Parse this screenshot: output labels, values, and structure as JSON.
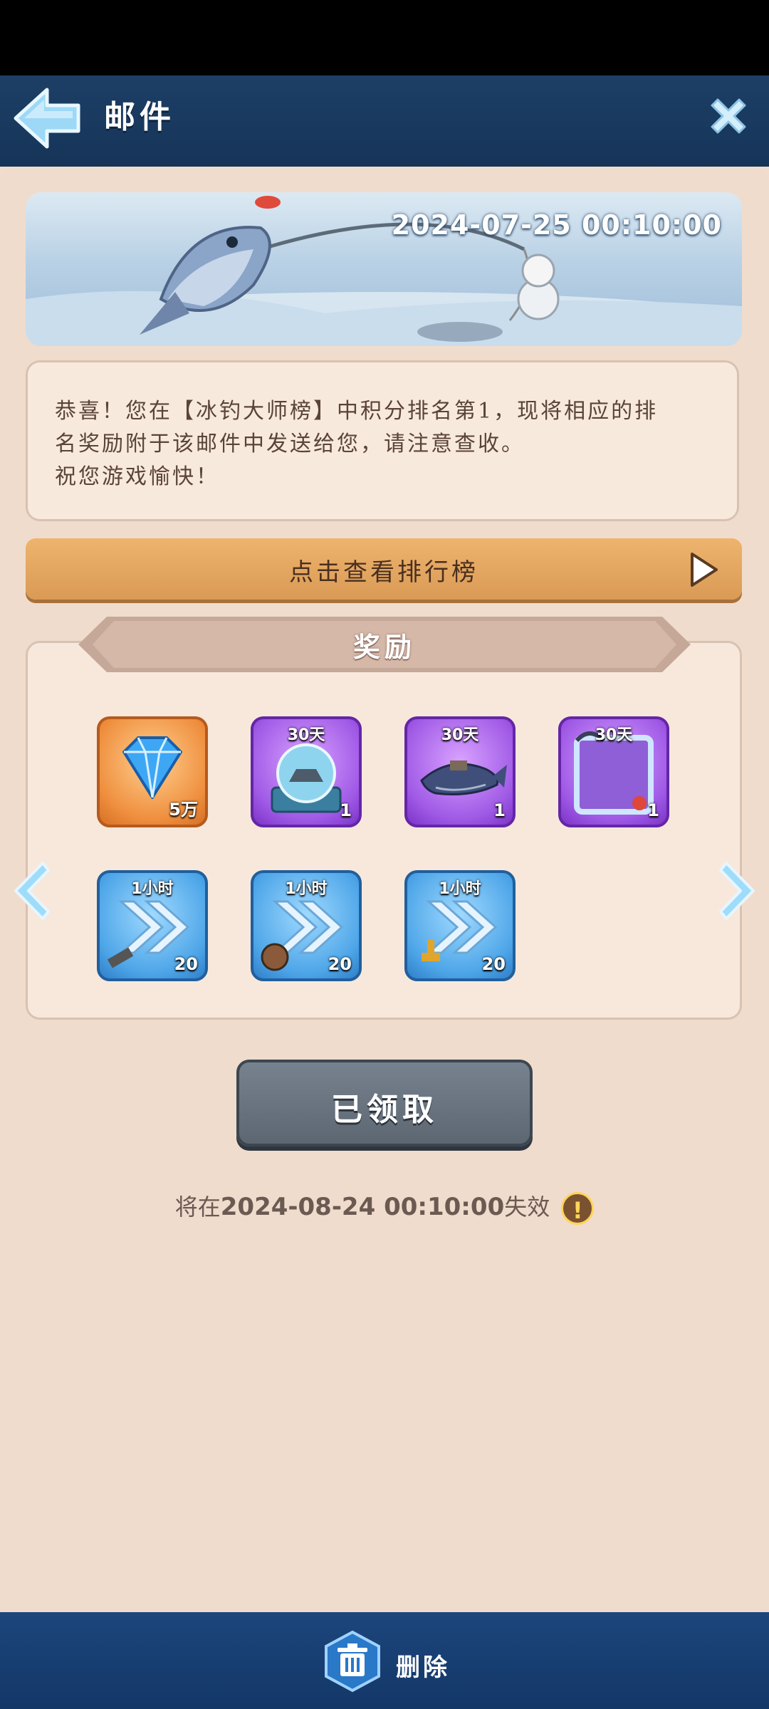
{
  "header": {
    "title": "邮件",
    "back_icon": "back-arrow-icon",
    "close_icon": "close-icon"
  },
  "mail": {
    "date": "2024-07-25 00:10:00",
    "body_lines": [
      "恭喜！您在【冰钓大师榜】中积分排名第1，现将相应的排",
      "名奖励附于该邮件中发送给您，请注意查收。",
      "祝您游戏愉快！"
    ]
  },
  "leaderboard_button": {
    "label": "点击查看排行榜"
  },
  "rewards": {
    "title": "奖励",
    "items": [
      {
        "icon": "diamond-icon",
        "tag": "",
        "qty": "5万"
      },
      {
        "icon": "aquarium-globe-icon",
        "tag": "30天",
        "qty": "1"
      },
      {
        "icon": "whale-icon",
        "tag": "30天",
        "qty": "1"
      },
      {
        "icon": "avatar-frame-icon",
        "tag": "30天",
        "qty": "1"
      },
      {
        "icon": "speedup-build-icon",
        "tag": "1小时",
        "qty": "20"
      },
      {
        "icon": "speedup-train-icon",
        "tag": "1小时",
        "qty": "20"
      },
      {
        "icon": "speedup-research-icon",
        "tag": "1小时",
        "qty": "20"
      }
    ]
  },
  "claim_button": {
    "label": "已领取"
  },
  "expiry": {
    "prefix": "将在",
    "date": "2024-08-24 00:10:00",
    "suffix": "失效"
  },
  "footer": {
    "delete_label": "删除"
  }
}
